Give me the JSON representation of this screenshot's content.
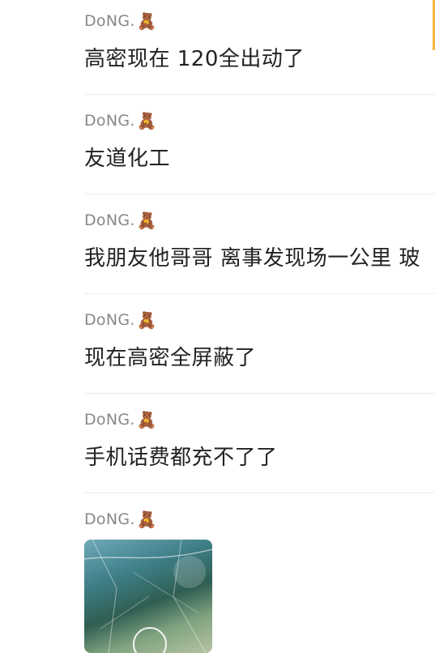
{
  "messages": [
    {
      "sender": "DoNG.",
      "text": "高密现在 120全出动了"
    },
    {
      "sender": "DoNG.",
      "text": "友道化工"
    },
    {
      "sender": "DoNG.",
      "text": "我朋友他哥哥 离事发现场一公里 玻"
    },
    {
      "sender": "DoNG.",
      "text": "现在高密全屏蔽了"
    },
    {
      "sender": "DoNG.",
      "text": "手机话费都充不了了"
    },
    {
      "sender": "DoNG.",
      "text": ""
    }
  ],
  "colors": {
    "sender": "#888888",
    "text": "#222222",
    "divider": "#ececec",
    "accent": "#f5b83d"
  },
  "icons": {
    "sender_badge": "teddy-bear-icon",
    "video_play": "play-icon"
  }
}
